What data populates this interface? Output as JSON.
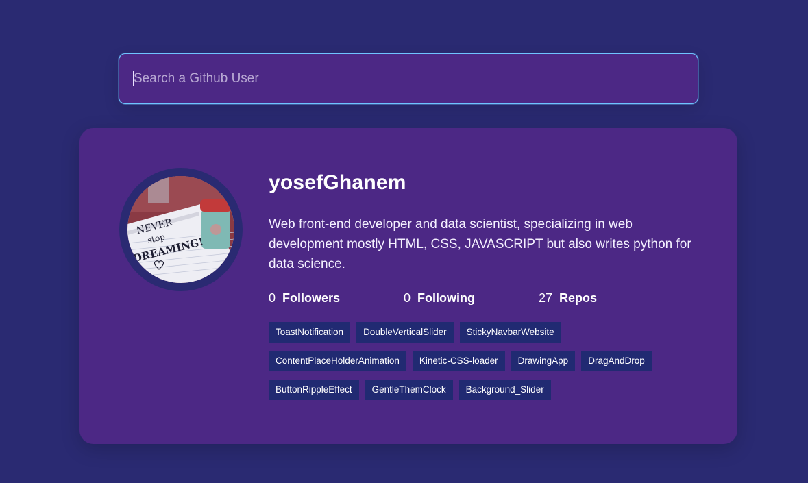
{
  "search": {
    "placeholder": "Search a Github User",
    "value": ""
  },
  "profile": {
    "username": "yosefGhanem",
    "bio": "Web front-end developer and data scientist, specializing in web development mostly HTML, CSS, JAVASCRIPT but also writes python for data science.",
    "avatar_text": "NEVER STOP DREAMING!",
    "stats": {
      "followers_count": "0",
      "followers_label": "Followers",
      "following_count": "0",
      "following_label": "Following",
      "repos_count": "27",
      "repos_label": "Repos"
    },
    "repos": [
      "ToastNotification",
      "DoubleVerticalSlider",
      "StickyNavbarWebsite",
      "ContentPlaceHolderAnimation",
      "Kinetic-CSS-loader",
      "DrawingApp",
      "DragAndDrop",
      "ButtonRippleEffect",
      "GentleThemClock",
      "Background_Slider"
    ]
  },
  "colors": {
    "background": "#2a2a72",
    "card": "#4c2885",
    "repo_tag": "#212a72",
    "search_border": "#6fc3ff"
  }
}
